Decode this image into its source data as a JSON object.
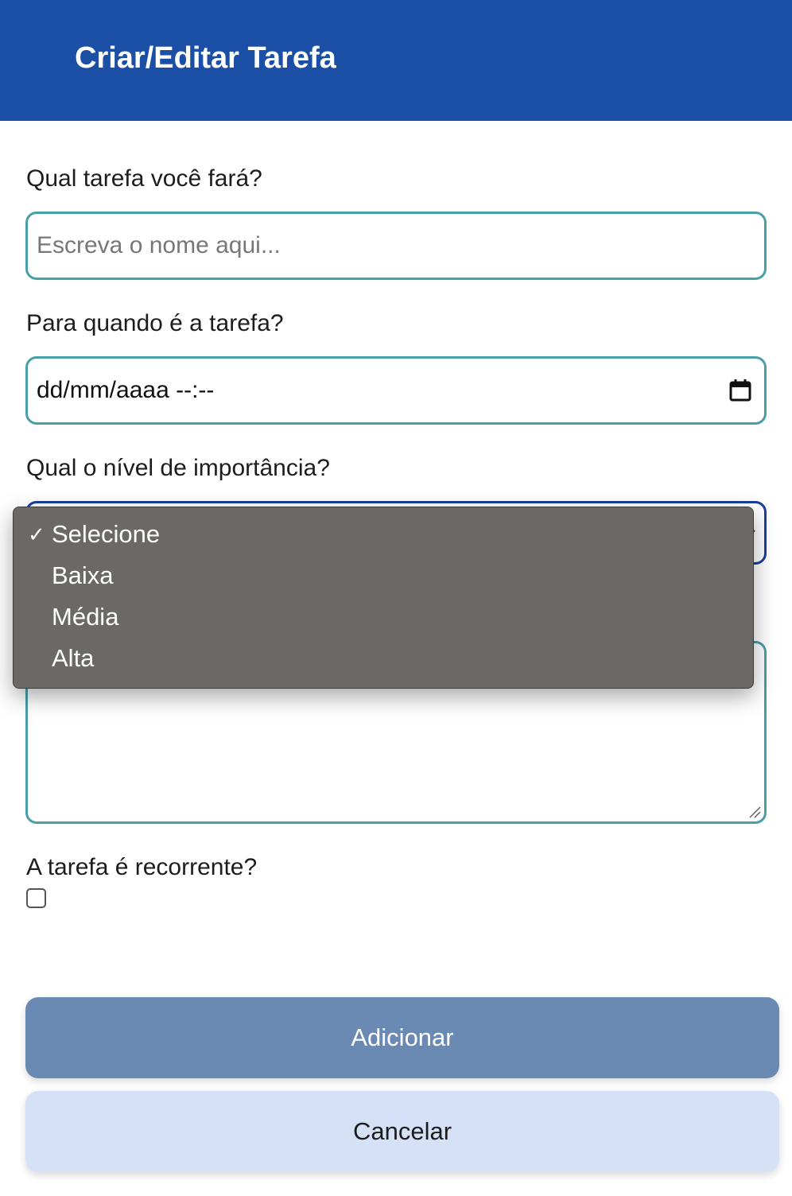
{
  "header": {
    "title": "Criar/Editar Tarefa"
  },
  "form": {
    "name_label": "Qual tarefa você fará?",
    "name_placeholder": "Escreva o nome aqui...",
    "date_label": "Para quando é a tarefa?",
    "date_value": "dd/mm/aaaa --:--",
    "importance_label": "Qual o nível de importância?",
    "importance_selected": "Selecione",
    "recurring_label": "A tarefa é recorrente?",
    "recurring_checked": false
  },
  "dropdown": {
    "check_glyph": "✓",
    "options": [
      "Selecione",
      "Baixa",
      "Média",
      "Alta"
    ]
  },
  "buttons": {
    "add_label": "Adicionar",
    "cancel_label": "Cancelar"
  },
  "colors": {
    "header": "#1b4ea5",
    "field_border": "#4a9ea5",
    "add_button": "#6a8ab3",
    "cancel_button": "#d5e1f7"
  },
  "icons": {
    "date": "calendar-icon",
    "select": "chevron-down-icon",
    "textarea": "resize-handle-icon"
  }
}
